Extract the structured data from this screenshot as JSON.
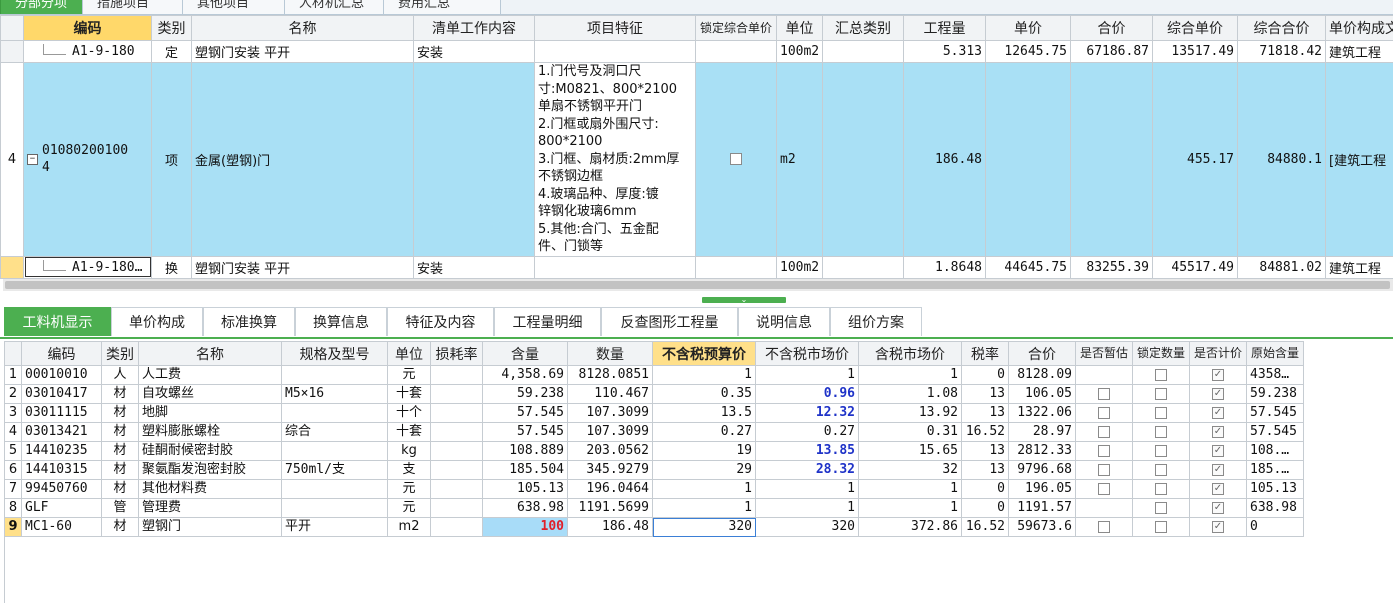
{
  "top_tabs": [
    "分部分项",
    "措施项目",
    "其他项目",
    "人材机汇总",
    "费用汇总"
  ],
  "upper_headers": {
    "code": "编码",
    "category": "类别",
    "name": "名称",
    "work_content": "清单工作内容",
    "features": "项目特征",
    "lock_price": "锁定综合单价",
    "unit": "单位",
    "summary_type": "汇总类别",
    "quantity": "工程量",
    "unit_price": "单价",
    "total": "合价",
    "comp_unit_price": "综合单价",
    "comp_total": "综合合价",
    "price_file": "单价构成文"
  },
  "upper_rows": {
    "r1": {
      "code": "A1-9-180",
      "category": "定",
      "name": "塑钢门安装 平开",
      "work_content": "安装",
      "unit": "100m2",
      "quantity": "5.313",
      "unit_price": "12645.75",
      "total": "67186.87",
      "comp_unit_price": "13517.49",
      "comp_total": "71818.42",
      "price_file": "建筑工程"
    },
    "r2": {
      "row_no": "4",
      "expand": "−",
      "code_line1": "01080200100",
      "code_line2": "4",
      "category": "项",
      "name": "金属(塑钢)门",
      "features": [
        "1.门代号及洞口尺",
        "寸:M0821、800*2100",
        "单扇不锈钢平开门",
        "2.门框或扇外围尺寸:",
        "800*2100",
        "3.门框、扇材质:2mm厚",
        "不锈钢边框",
        "4.玻璃品种、厚度:镀",
        "锌钢化玻璃6mm",
        "5.其他:合门、五金配",
        "件、门锁等"
      ],
      "unit": "m2",
      "quantity": "186.48",
      "comp_unit_price": "455.17",
      "comp_total": "84880.1",
      "price_file": "[建筑工程"
    },
    "r3": {
      "code": "A1-9-180…",
      "category": "换",
      "name": "塑钢门安装 平开",
      "work_content": "安装",
      "unit": "100m2",
      "quantity": "1.8648",
      "unit_price": "44645.75",
      "total": "83255.39",
      "comp_unit_price": "45517.49",
      "comp_total": "84881.02",
      "price_file": "建筑工程"
    }
  },
  "bottom_tabs": [
    "工料机显示",
    "单价构成",
    "标准换算",
    "换算信息",
    "特征及内容",
    "工程量明细",
    "反查图形工程量",
    "说明信息",
    "组价方案"
  ],
  "lower_headers": {
    "code": "编码",
    "category": "类别",
    "name": "名称",
    "spec": "规格及型号",
    "unit": "单位",
    "loss": "损耗率",
    "content": "含量",
    "amount": "数量",
    "pre_tax_budget": "不含税预算价",
    "pre_tax_market": "不含税市场价",
    "tax_market": "含税市场价",
    "tax_rate": "税率",
    "total": "合价",
    "is_provisional": "是否暂估",
    "lock_qty": "锁定数量",
    "is_priced": "是否计价",
    "orig_content": "原始含量"
  },
  "lower_rows": [
    {
      "no": "1",
      "code": "00010010",
      "cat": "人",
      "name": "人工费",
      "spec": "",
      "unit": "元",
      "content": "4,358.69",
      "amount": "8128.0851",
      "budget": "1",
      "market": "1",
      "tax_market": "1",
      "rate": "0",
      "total": "8128.09",
      "prov": "",
      "lock": "",
      "priced": "✓",
      "orig": "4358…"
    },
    {
      "no": "2",
      "code": "03010417",
      "cat": "材",
      "name": "自攻螺丝",
      "spec": "M5×16",
      "unit": "十套",
      "content": "59.238",
      "amount": "110.467",
      "budget": "0.35",
      "market": "0.96",
      "tax_market": "1.08",
      "rate": "13",
      "total": "106.05",
      "prov": "□",
      "lock": "",
      "priced": "✓",
      "orig": "59.238"
    },
    {
      "no": "3",
      "code": "03011115",
      "cat": "材",
      "name": "地脚",
      "spec": "",
      "unit": "十个",
      "content": "57.545",
      "amount": "107.3099",
      "budget": "13.5",
      "market": "12.32",
      "tax_market": "13.92",
      "rate": "13",
      "total": "1322.06",
      "prov": "□",
      "lock": "",
      "priced": "✓",
      "orig": "57.545"
    },
    {
      "no": "4",
      "code": "03013421",
      "cat": "材",
      "name": "塑料膨胀螺栓",
      "spec": "综合",
      "unit": "十套",
      "content": "57.545",
      "amount": "107.3099",
      "budget": "0.27",
      "market": "0.27",
      "tax_market": "0.31",
      "rate": "16.52",
      "total": "28.97",
      "prov": "□",
      "lock": "",
      "priced": "✓",
      "orig": "57.545"
    },
    {
      "no": "5",
      "code": "14410235",
      "cat": "材",
      "name": "硅酮耐候密封胶",
      "spec": "",
      "unit": "kg",
      "content": "108.889",
      "amount": "203.0562",
      "budget": "19",
      "market": "13.85",
      "tax_market": "15.65",
      "rate": "13",
      "total": "2812.33",
      "prov": "□",
      "lock": "",
      "priced": "✓",
      "orig": "108.…"
    },
    {
      "no": "6",
      "code": "14410315",
      "cat": "材",
      "name": "聚氨酯发泡密封胶",
      "spec": "750ml/支",
      "unit": "支",
      "content": "185.504",
      "amount": "345.9279",
      "budget": "29",
      "market": "28.32",
      "tax_market": "32",
      "rate": "13",
      "total": "9796.68",
      "prov": "□",
      "lock": "",
      "priced": "✓",
      "orig": "185.…"
    },
    {
      "no": "7",
      "code": "99450760",
      "cat": "材",
      "name": "其他材料费",
      "spec": "",
      "unit": "元",
      "content": "105.13",
      "amount": "196.0464",
      "budget": "1",
      "market": "1",
      "tax_market": "1",
      "rate": "0",
      "total": "196.05",
      "prov": "□",
      "lock": "",
      "priced": "✓",
      "orig": "105.13"
    },
    {
      "no": "8",
      "code": "GLF",
      "cat": "管",
      "name": "管理费",
      "spec": "",
      "unit": "元",
      "content": "638.98",
      "amount": "1191.5699",
      "budget": "1",
      "market": "1",
      "tax_market": "1",
      "rate": "0",
      "total": "1191.57",
      "prov": "",
      "lock": "",
      "priced": "✓",
      "orig": "638.98"
    },
    {
      "no": "9",
      "code": "MC1-60",
      "cat": "材",
      "name": "塑钢门",
      "spec": "平开",
      "unit": "m2",
      "content": "100",
      "amount": "186.48",
      "budget": "320",
      "market": "320",
      "tax_market": "372.86",
      "rate": "16.52",
      "total": "59673.6",
      "prov": "□",
      "lock": "",
      "priced": "✓",
      "orig": "0"
    }
  ],
  "colors": {
    "accent": "#4caf50",
    "selected_row": "#a9e0f5",
    "header_highlight": "#ffe08a",
    "blue_text": "#1f33c8",
    "red_text": "#e0202a"
  }
}
